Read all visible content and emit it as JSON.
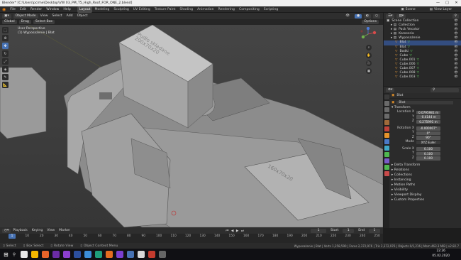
{
  "window": {
    "title": "Blender* [C:\\Users\\pcrme\\Desktop\\VW 03_PM_T5_High_Roof_FOR_ONE_2.blend]",
    "controls": [
      "—",
      "□",
      "✕"
    ]
  },
  "menubar": {
    "menus": [
      "File",
      "Edit",
      "Render",
      "Window",
      "Help"
    ],
    "workspaces": [
      "Layout",
      "Modeling",
      "Sculpting",
      "UV Editing",
      "Texture Paint",
      "Shading",
      "Animation",
      "Rendering",
      "Compositing",
      "Scripting"
    ],
    "active_workspace": "Layout",
    "scene_label": "Scene",
    "view_layer_label": "View Layer"
  },
  "viewport_header": {
    "mode": "Object Mode",
    "menus": [
      "View",
      "Select",
      "Add",
      "Object"
    ],
    "transform": "Global",
    "snap": "Drag",
    "select_box": "Select Box",
    "orientation": "Orientation",
    "options": "Options"
  },
  "viewport": {
    "perspective": "User Perspective",
    "collection": "(1) Wyposażenie | Blat",
    "box_label_top": "Pudło składane 200x70x20",
    "box_label_floor": "160x70x20",
    "tools": [
      "select-icon",
      "cursor-icon",
      "move-icon",
      "rotate-icon",
      "scale-icon",
      "transform-icon",
      "annotate-icon",
      "measure-icon"
    ],
    "nav_buttons": [
      "zoom-icon",
      "pan-icon",
      "camera-icon",
      "grid-icon"
    ]
  },
  "timeline": {
    "menus": [
      "Playback",
      "Keying",
      "View",
      "Marker"
    ],
    "current_frame": "1",
    "start_label": "Start",
    "start_value": "1",
    "end_label": "End",
    "end_value": "1",
    "ticks": [
      "0",
      "10",
      "20",
      "30",
      "40",
      "50",
      "60",
      "70",
      "80",
      "90",
      "100",
      "110",
      "120",
      "130",
      "140",
      "150",
      "160",
      "170",
      "180",
      "190",
      "200",
      "210",
      "220",
      "230",
      "240",
      "250"
    ]
  },
  "statusbar": {
    "left": [
      "Select",
      "Box Select",
      "Rotate View",
      "Object Context Menu"
    ],
    "right": "Wyposażenie | Blat | Verts 1,258,590 | Faces 2,372,976 | Tris 2,372,976 | Objects 0/1,216 | Mem 463.3 MiB | v2.82.7"
  },
  "outliner": {
    "title": "Scene Collection",
    "rows": [
      {
        "name": "Scene Collection",
        "indent": 0,
        "kind": "root",
        "selected": false
      },
      {
        "name": "Collection",
        "indent": 1,
        "kind": "coll",
        "selected": false
      },
      {
        "name": "Pack Vecotor",
        "indent": 1,
        "kind": "coll",
        "selected": false
      },
      {
        "name": "Karoseria",
        "indent": 1,
        "kind": "coll",
        "selected": false
      },
      {
        "name": "Wyposażenie",
        "indent": 1,
        "kind": "coll",
        "selected": false
      },
      {
        "name": "Blat",
        "indent": 2,
        "kind": "mesh",
        "selected": true
      },
      {
        "name": "Blat",
        "indent": 2,
        "kind": "mesh",
        "selected": false
      },
      {
        "name": "Bodki",
        "indent": 2,
        "kind": "mesh",
        "selected": false
      },
      {
        "name": "Cube",
        "indent": 2,
        "kind": "mesh",
        "selected": false
      },
      {
        "name": "Cube.001",
        "indent": 2,
        "kind": "mesh",
        "selected": false
      },
      {
        "name": "Cube.006",
        "indent": 2,
        "kind": "mesh",
        "selected": false
      },
      {
        "name": "Cube.007",
        "indent": 2,
        "kind": "mesh",
        "selected": false
      },
      {
        "name": "Cube.008",
        "indent": 2,
        "kind": "mesh",
        "selected": false
      },
      {
        "name": "Cube.003",
        "indent": 2,
        "kind": "mesh",
        "selected": false
      }
    ]
  },
  "properties": {
    "object_name": "Blat",
    "object_name2": "Blat",
    "transform_title": "Transform",
    "location_label": "Location X",
    "location": [
      "0.0795981 m",
      "-0.4144 m",
      "0.275991 m"
    ],
    "rotation_label": "Rotation X",
    "rotation": [
      "-0.000007°",
      "0°",
      "90°"
    ],
    "mode_label": "Mode",
    "mode_value": "XYZ Euler",
    "scale_label": "Scale X",
    "scale": [
      "0.100",
      "0.100",
      "0.100"
    ],
    "axis": [
      "Y",
      "Z"
    ],
    "sections": [
      "Delta Transform",
      "Relations",
      "Collections",
      "Instancing",
      "Motion Paths",
      "Visibility",
      "Viewport Display",
      "Custom Properties"
    ]
  },
  "taskbar": {
    "search_label": "Type here to search",
    "time": "22:26",
    "date": "05.02.2020",
    "apps": [
      "#e8e8e8",
      "#f5b800",
      "#e8642a",
      "#6b2ca8",
      "#8b3fcf",
      "#2c4fa0",
      "#3c8dd8",
      "#1e9e7a",
      "#e36d20",
      "#7a3fd0",
      "#4772b3",
      "#d8d8d8",
      "#c43b2e",
      "#666"
    ]
  }
}
